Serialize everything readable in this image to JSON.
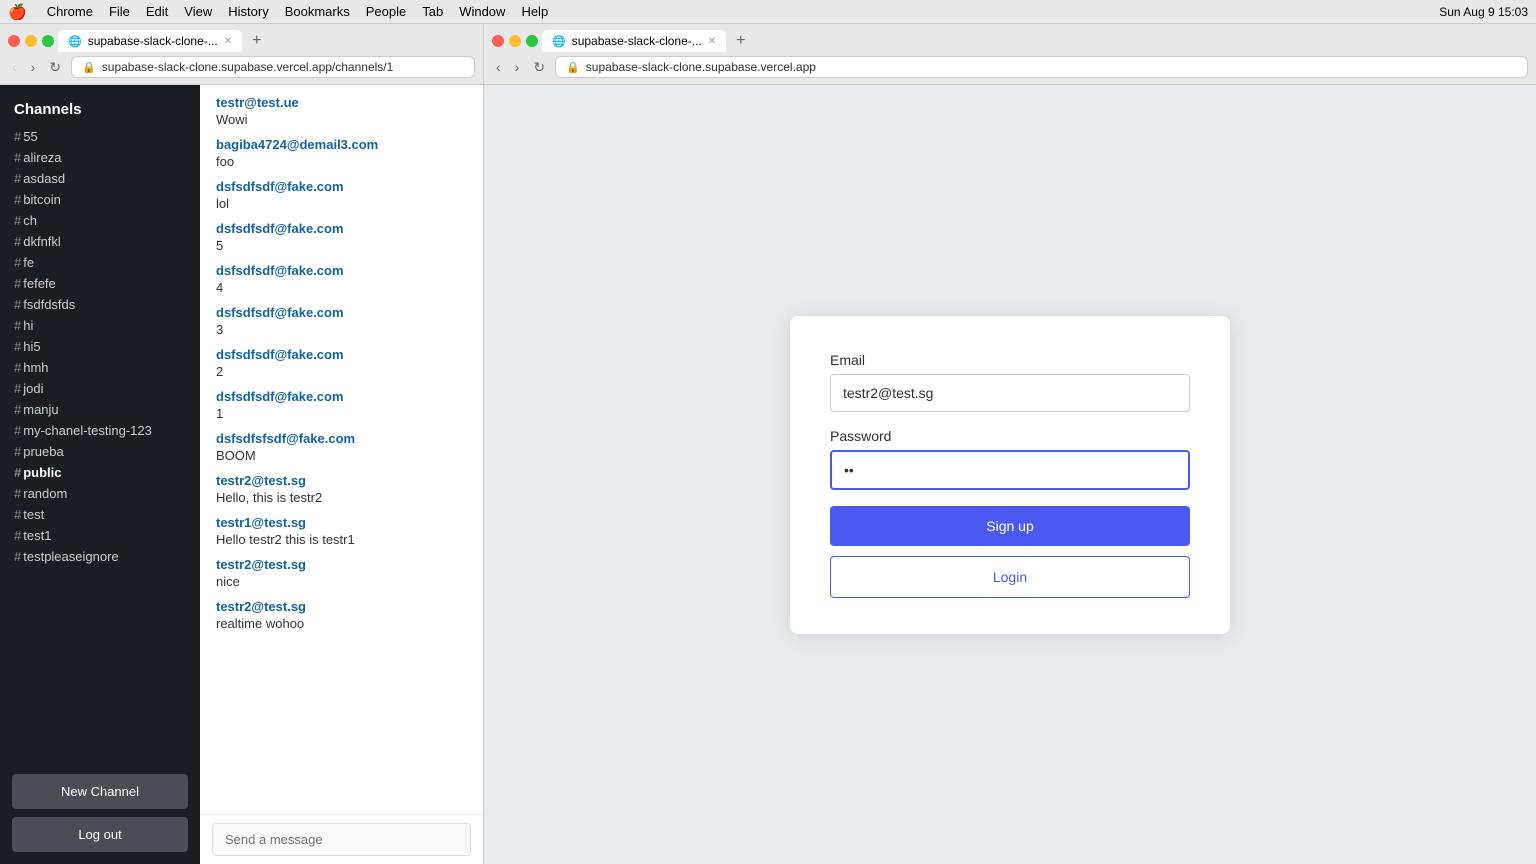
{
  "menubar": {
    "apple": "🍎",
    "items": [
      "Chrome",
      "File",
      "Edit",
      "View",
      "History",
      "Bookmarks",
      "People",
      "Tab",
      "Window",
      "Help"
    ],
    "right": "Sun Aug 9  15:03"
  },
  "left_browser": {
    "tab_url": "https://supabase-slack-clone...",
    "address": "supabase-slack-clone.supabase.vercel.app/channels/1",
    "tab_label": "supabase-slack-clone-..."
  },
  "right_browser": {
    "tab_url": "https://supabase-slack-clone-...",
    "address": "supabase-slack-clone.supabase.vercel.app",
    "tab_label": "supabase-slack-clone-..."
  },
  "sidebar": {
    "title": "Channels",
    "channels": [
      {
        "name": "55",
        "bold": false
      },
      {
        "name": "alireza",
        "bold": false
      },
      {
        "name": "asdasd",
        "bold": false
      },
      {
        "name": "bitcoin",
        "bold": false
      },
      {
        "name": "ch",
        "bold": false
      },
      {
        "name": "dkfnfkl",
        "bold": false
      },
      {
        "name": "fe",
        "bold": false
      },
      {
        "name": "fefefe",
        "bold": false
      },
      {
        "name": "fsdfdsfds",
        "bold": false
      },
      {
        "name": "hi",
        "bold": false
      },
      {
        "name": "hi5",
        "bold": false
      },
      {
        "name": "hmh",
        "bold": false
      },
      {
        "name": "jodi",
        "bold": false
      },
      {
        "name": "manju",
        "bold": false
      },
      {
        "name": "my-chanel-testing-123",
        "bold": false
      },
      {
        "name": "prueba",
        "bold": false
      },
      {
        "name": "public",
        "bold": true
      },
      {
        "name": "random",
        "bold": false
      },
      {
        "name": "test",
        "bold": false
      },
      {
        "name": "test1",
        "bold": false
      },
      {
        "name": "testpleaseignore",
        "bold": false
      }
    ],
    "new_channel_label": "New Channel",
    "logout_label": "Log out"
  },
  "messages": [
    {
      "sender": "testr@test.ue",
      "text": "Wowi"
    },
    {
      "sender": "bagiba4724@demail3.com",
      "text": "foo"
    },
    {
      "sender": "dsfsdfsdf@fake.com",
      "text": "lol"
    },
    {
      "sender": "dsfsdfsdf@fake.com",
      "text": "5"
    },
    {
      "sender": "dsfsdfsdf@fake.com",
      "text": "4"
    },
    {
      "sender": "dsfsdfsdf@fake.com",
      "text": "3"
    },
    {
      "sender": "dsfsdfsdf@fake.com",
      "text": "2"
    },
    {
      "sender": "dsfsdfsdf@fake.com",
      "text": "1"
    },
    {
      "sender": "dsfsdfsfsdf@fake.com",
      "text": "BOOM"
    },
    {
      "sender": "testr2@test.sg",
      "text": "Hello, this is testr2"
    },
    {
      "sender": "testr1@test.sg",
      "text": "Hello testr2 this is testr1"
    },
    {
      "sender": "testr2@test.sg",
      "text": "nice"
    },
    {
      "sender": "testr2@test.sg",
      "text": "realtime wohoo"
    }
  ],
  "message_input_placeholder": "Send a message",
  "auth": {
    "email_label": "Email",
    "email_value": "testr2@test.sg",
    "password_label": "Password",
    "password_value": "••",
    "signup_label": "Sign up",
    "login_label": "Login"
  }
}
